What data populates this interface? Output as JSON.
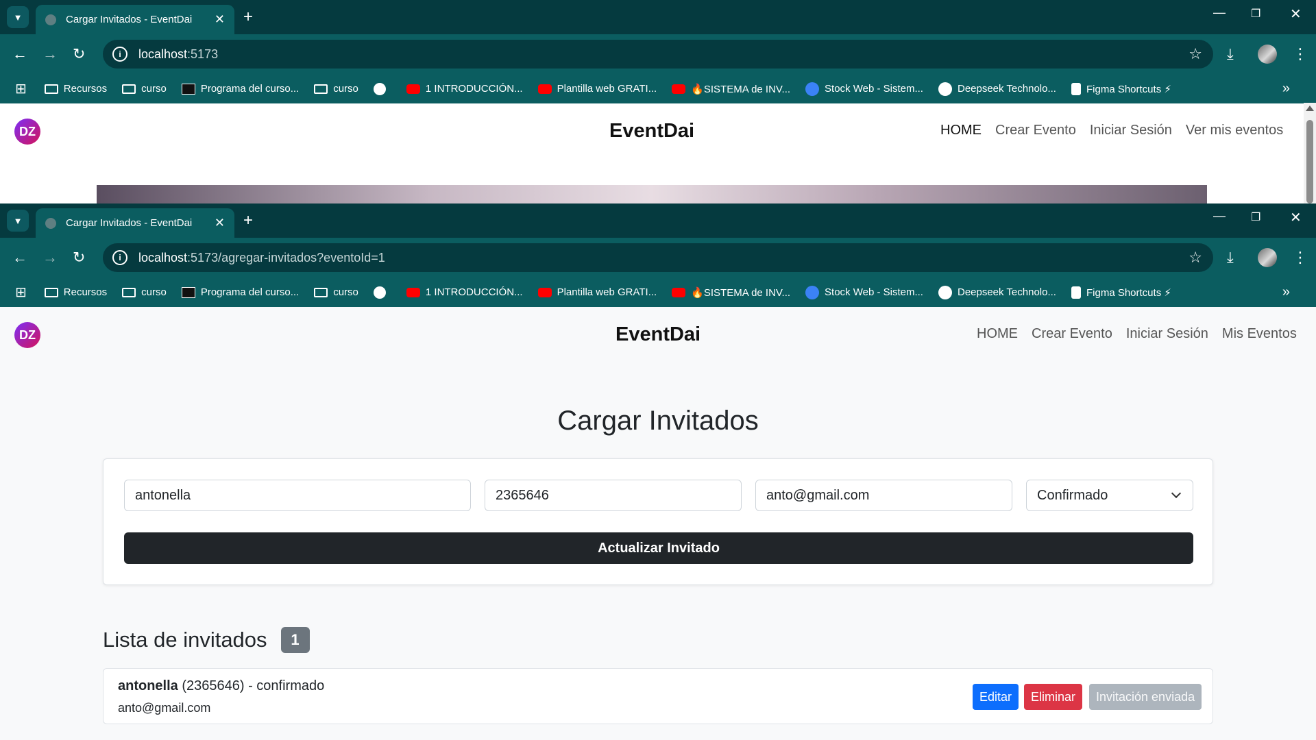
{
  "browser": {
    "windows": [
      {
        "tab_title": "Cargar Invitados - EventDai",
        "url_host": "localhost",
        "url_path": ":5173"
      },
      {
        "tab_title": "Cargar Invitados - EventDai",
        "url_host": "localhost",
        "url_path": ":5173/agregar-invitados?eventoId=1"
      }
    ],
    "bookmarks": [
      {
        "label": "Recursos",
        "icon": "folder-icon"
      },
      {
        "label": "curso",
        "icon": "folder-icon"
      },
      {
        "label": "Programa del curso...",
        "icon": "site-icon"
      },
      {
        "label": "curso",
        "icon": "folder-icon"
      },
      {
        "label": "",
        "icon": "globe-icon"
      },
      {
        "label": "1 INTRODUCCIÓN...",
        "icon": "youtube-icon"
      },
      {
        "label": "Plantilla web GRATI...",
        "icon": "youtube-icon"
      },
      {
        "label": "🔥SISTEMA de INV...",
        "icon": "youtube-icon"
      },
      {
        "label": "Stock Web - Sistem...",
        "icon": "site-icon"
      },
      {
        "label": "Deepseek Technolo...",
        "icon": "deepseek-icon"
      },
      {
        "label": "Figma Shortcuts ⚡",
        "icon": "figma-icon"
      }
    ]
  },
  "site": {
    "logo_text": "DZ",
    "brand": "EventDai",
    "nav_window1": [
      "HOME",
      "Crear Evento",
      "Iniciar Sesión",
      "Ver mis eventos"
    ],
    "nav_window2": [
      "HOME",
      "Crear Evento",
      "Iniciar Sesión",
      "Mis Eventos"
    ]
  },
  "form": {
    "title": "Cargar Invitados",
    "name_value": "antonella",
    "phone_value": "2365646",
    "email_value": "anto@gmail.com",
    "status_value": "Confirmado",
    "submit_label": "Actualizar Invitado"
  },
  "list": {
    "title": "Lista de invitados",
    "count": "1",
    "items": [
      {
        "name": "antonella",
        "detail": " (2365646) - confirmado",
        "email": "anto@gmail.com",
        "edit_label": "Editar",
        "delete_label": "Eliminar",
        "sent_label": "Invitación enviada"
      }
    ]
  }
}
